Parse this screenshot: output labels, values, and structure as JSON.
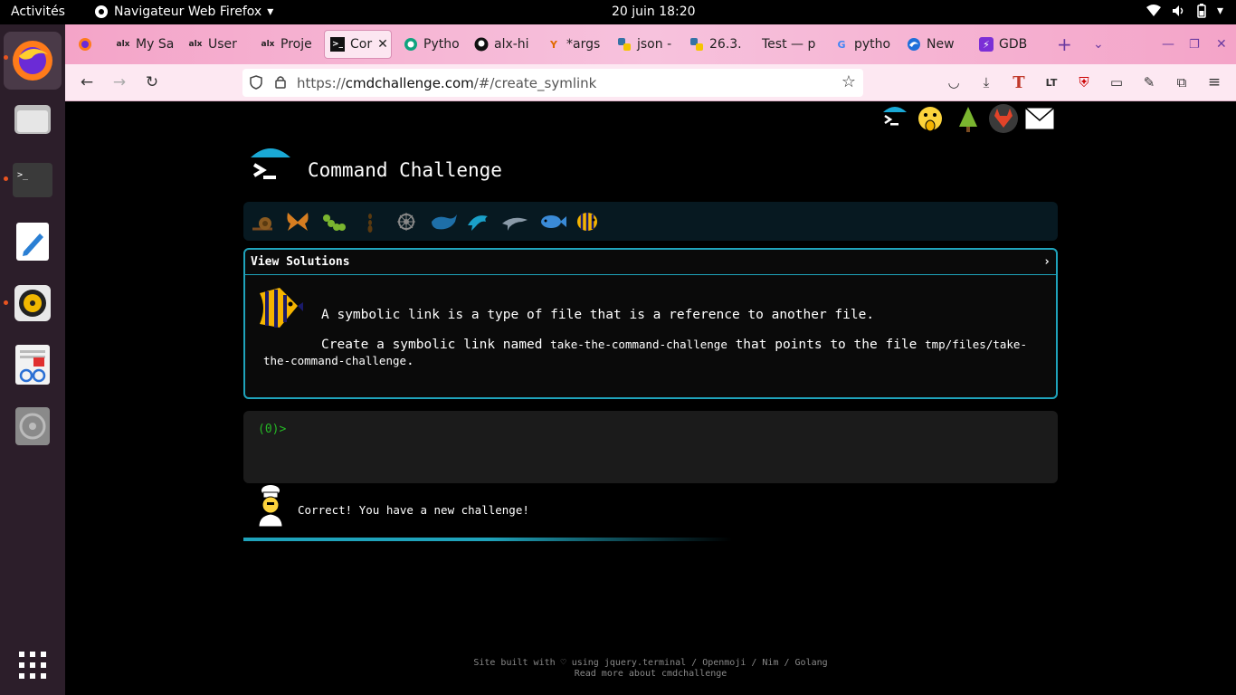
{
  "topbar": {
    "activities": "Activités",
    "app_name": "Navigateur Web Firefox",
    "clock": "20 juin  18:20"
  },
  "browser": {
    "tabs": [
      {
        "label": "My Sa",
        "icon": "alx"
      },
      {
        "label": "User",
        "icon": "alx"
      },
      {
        "label": "Proje",
        "icon": "alx"
      },
      {
        "label": "Cor",
        "icon": "terminal-icon",
        "active": true
      },
      {
        "label": "Pytho",
        "icon": "openai-icon"
      },
      {
        "label": "alx-hi",
        "icon": "github-icon"
      },
      {
        "label": "*args",
        "icon": "ycombinator-icon"
      },
      {
        "label": "json -",
        "icon": "python-icon"
      },
      {
        "label": "26.3.",
        "icon": "python-icon"
      },
      {
        "label": "Test — p",
        "icon": ""
      },
      {
        "label": "pytho",
        "icon": "google-icon"
      },
      {
        "label": "New",
        "icon": "edge-icon"
      },
      {
        "label": "GDB",
        "icon": "bolt-icon"
      }
    ],
    "url_prefix": "https://",
    "url_host": "cmdchallenge.com",
    "url_path": "/#/create_symlink"
  },
  "page": {
    "title": "Command Challenge",
    "view_solutions": "View Solutions",
    "chevron": "›",
    "desc1": "A symbolic link is a type of file that is a reference to another file.",
    "desc2_a": "Create a symbolic link named ",
    "desc2_code1": "take-the-command-challenge",
    "desc2_b": " that points to the file ",
    "desc2_code2": "tmp/files/take-the-command-challenge",
    "desc2_c": ".",
    "prompt": "(0)>",
    "result": "Correct! You have a new challenge!",
    "footer_line1": "Site built with ♡ using jquery.terminal / Openmoji / Nim / Golang",
    "footer_line2": "Read more about cmdchallenge",
    "progress": 0.6
  },
  "colors": {
    "accent": "#1fa3bb",
    "prompt": "#25b825",
    "tab_bar": "#f4a4c8"
  }
}
